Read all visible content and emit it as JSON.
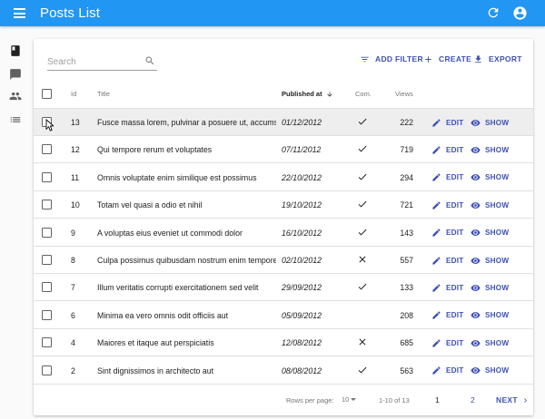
{
  "app": {
    "title": "Posts List"
  },
  "colors": {
    "appbar": "#2196f3",
    "accent": "#3f51b5"
  },
  "icons": {
    "menu": "menu-icon",
    "refresh": "refresh-icon",
    "account": "account-circle-icon"
  },
  "sidebar": {
    "items": [
      {
        "icon": "book-icon",
        "name": "posts"
      },
      {
        "icon": "comment-icon",
        "name": "comments"
      },
      {
        "icon": "people-icon",
        "name": "users"
      },
      {
        "icon": "list-icon",
        "name": "categories"
      }
    ]
  },
  "search": {
    "placeholder": "Search",
    "value": ""
  },
  "toolbar": {
    "add_filter": "ADD FILTER",
    "create": "CREATE",
    "export": "EXPORT"
  },
  "columns": {
    "id": "Id",
    "title": "Title",
    "published_at": "Published at",
    "com": "Com.",
    "views": "Views"
  },
  "actions": {
    "edit": "EDIT",
    "show": "SHOW"
  },
  "rows": [
    {
      "id": "13",
      "title": "Fusce massa lorem, pulvinar a posuere ut, accumsan",
      "published_at": "01/12/2012",
      "commentable": true,
      "views": "222"
    },
    {
      "id": "12",
      "title": "Qui tempore rerum et voluptates",
      "published_at": "07/11/2012",
      "commentable": true,
      "views": "719"
    },
    {
      "id": "11",
      "title": "Omnis voluptate enim similique est possimus",
      "published_at": "22/10/2012",
      "commentable": true,
      "views": "294"
    },
    {
      "id": "10",
      "title": "Totam vel quasi a odio et nihil",
      "published_at": "19/10/2012",
      "commentable": true,
      "views": "721"
    },
    {
      "id": "9",
      "title": "A voluptas eius eveniet ut commodi dolor",
      "published_at": "16/10/2012",
      "commentable": true,
      "views": "143"
    },
    {
      "id": "8",
      "title": "Culpa possimus quibusdam nostrum enim tempore",
      "published_at": "02/10/2012",
      "commentable": false,
      "views": "557"
    },
    {
      "id": "7",
      "title": "Illum veritatis corrupti exercitationem sed velit",
      "published_at": "29/09/2012",
      "commentable": true,
      "views": "133"
    },
    {
      "id": "6",
      "title": "Minima ea vero omnis odit officiis aut",
      "published_at": "05/09/2012",
      "commentable": null,
      "views": "208"
    },
    {
      "id": "4",
      "title": "Maiores et itaque aut perspiciatis",
      "published_at": "12/08/2012",
      "commentable": false,
      "views": "685"
    },
    {
      "id": "2",
      "title": "Sint dignissimos in architecto aut",
      "published_at": "08/08/2012",
      "commentable": true,
      "views": "563"
    }
  ],
  "pagination": {
    "rows_per_page_label": "Rows per page:",
    "rows_per_page": "10",
    "range": "1-10 of 13",
    "pages": [
      "1",
      "2"
    ],
    "current_page": "1",
    "next": "NEXT"
  }
}
